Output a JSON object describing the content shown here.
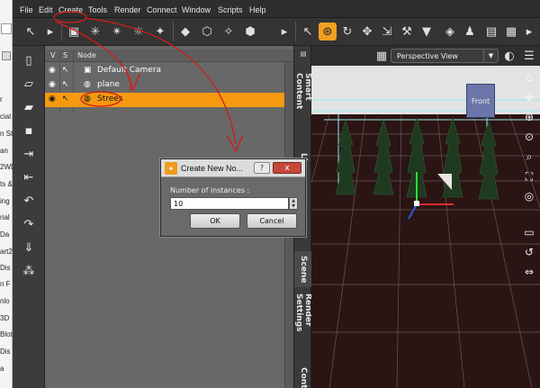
{
  "menubar": {
    "items": [
      "File",
      "Edit",
      "Create",
      "Tools",
      "Render",
      "Connect",
      "Window",
      "Scripts",
      "Help"
    ]
  },
  "background_window": {
    "fragments": [
      "r",
      "cial",
      "n St",
      "an",
      "2WD",
      "ts &",
      "ing",
      "rial",
      "Da",
      "art2",
      "Dis",
      "n F",
      "nlo",
      "3D",
      "Blot",
      "Dis",
      "a"
    ]
  },
  "scene": {
    "headers": {
      "visible": "V",
      "selectable": "S",
      "node": "Node"
    },
    "nodes": [
      {
        "label": "Default Camera",
        "selected": false
      },
      {
        "label": "plane",
        "selected": false
      },
      {
        "label": "Strees",
        "selected": true
      }
    ]
  },
  "side_tabs": [
    "Smart Content",
    "Li",
    "Scene",
    "Render Settings",
    "Cont"
  ],
  "viewport": {
    "camera_label": "Perspective View",
    "cube_label": "Front"
  },
  "dialog": {
    "title": "Create New No...",
    "help": "?",
    "close": "x",
    "field_label": "Number of instances :",
    "field_value": "10",
    "ok": "OK",
    "cancel": "Cancel"
  },
  "colors": {
    "selection": "#f59a0f",
    "annotation": "#d41a1a",
    "floor": "#2b1414"
  }
}
